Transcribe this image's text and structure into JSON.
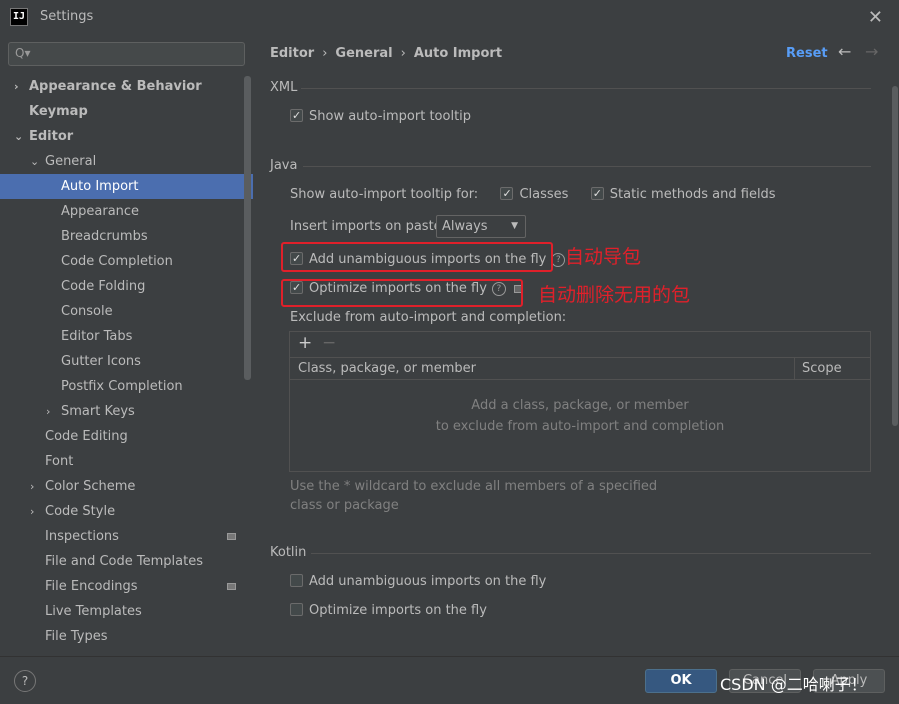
{
  "window": {
    "title": "Settings",
    "app_icon_text": "IJ"
  },
  "search": {
    "placeholder": "Q▾"
  },
  "sidebar": {
    "items": [
      {
        "label": "Appearance & Behavior",
        "level": 0,
        "bold": true,
        "chevron": "›"
      },
      {
        "label": "Keymap",
        "level": 0,
        "bold": true,
        "chevron": ""
      },
      {
        "label": "Editor",
        "level": 0,
        "bold": true,
        "chevron": "⌄"
      },
      {
        "label": "General",
        "level": 1,
        "bold": false,
        "chevron": "⌄"
      },
      {
        "label": "Auto Import",
        "level": 2,
        "bold": false,
        "chevron": "",
        "selected": true
      },
      {
        "label": "Appearance",
        "level": 2,
        "bold": false,
        "chevron": ""
      },
      {
        "label": "Breadcrumbs",
        "level": 2,
        "bold": false,
        "chevron": ""
      },
      {
        "label": "Code Completion",
        "level": 2,
        "bold": false,
        "chevron": ""
      },
      {
        "label": "Code Folding",
        "level": 2,
        "bold": false,
        "chevron": ""
      },
      {
        "label": "Console",
        "level": 2,
        "bold": false,
        "chevron": ""
      },
      {
        "label": "Editor Tabs",
        "level": 2,
        "bold": false,
        "chevron": ""
      },
      {
        "label": "Gutter Icons",
        "level": 2,
        "bold": false,
        "chevron": ""
      },
      {
        "label": "Postfix Completion",
        "level": 2,
        "bold": false,
        "chevron": ""
      },
      {
        "label": "Smart Keys",
        "level": 2,
        "bold": false,
        "chevron": "›"
      },
      {
        "label": "Code Editing",
        "level": 1,
        "bold": false,
        "chevron": ""
      },
      {
        "label": "Font",
        "level": 1,
        "bold": false,
        "chevron": ""
      },
      {
        "label": "Color Scheme",
        "level": 1,
        "bold": false,
        "chevron": "›"
      },
      {
        "label": "Code Style",
        "level": 1,
        "bold": false,
        "chevron": "›"
      },
      {
        "label": "Inspections",
        "level": 1,
        "bold": false,
        "chevron": "",
        "marker": true
      },
      {
        "label": "File and Code Templates",
        "level": 1,
        "bold": false,
        "chevron": ""
      },
      {
        "label": "File Encodings",
        "level": 1,
        "bold": false,
        "chevron": "",
        "marker": true
      },
      {
        "label": "Live Templates",
        "level": 1,
        "bold": false,
        "chevron": ""
      },
      {
        "label": "File Types",
        "level": 1,
        "bold": false,
        "chevron": ""
      }
    ]
  },
  "header": {
    "breadcrumb": [
      "Editor",
      "General",
      "Auto Import"
    ],
    "sep": "›",
    "reset_label": "Reset",
    "back_icon": "←",
    "forward_icon": "→"
  },
  "xml": {
    "title": "XML",
    "show_tooltip": {
      "label": "Show auto-import tooltip",
      "checked": true
    }
  },
  "java": {
    "title": "Java",
    "tooltip_for_label": "Show auto-import tooltip for:",
    "classes": {
      "label": "Classes",
      "checked": true
    },
    "static_methods": {
      "label": "Static methods and fields",
      "checked": true
    },
    "insert_label": "Insert imports on paste:",
    "insert_value": "Always",
    "add_unambiguous": {
      "label": "Add unambiguous imports on the fly",
      "checked": true
    },
    "optimize": {
      "label": "Optimize imports on the fly",
      "checked": true
    },
    "exclude_label": "Exclude from auto-import and completion:",
    "table": {
      "add_icon": "+",
      "remove_icon": "−",
      "col_main": "Class, package, or member",
      "col_scope": "Scope",
      "empty_line1": "Add a class, package, or member",
      "empty_line2": "to exclude from auto-import and completion"
    },
    "hint": "Use the * wildcard to exclude all members of a specified class or package"
  },
  "kotlin": {
    "title": "Kotlin",
    "add_unambiguous": {
      "label": "Add unambiguous imports on the fly",
      "checked": false
    },
    "optimize": {
      "label": "Optimize imports on the fly",
      "checked": false
    }
  },
  "annotations": {
    "note1": "自动导包",
    "note2": "自动删除无用的包",
    "color": "#e0202a"
  },
  "footer": {
    "help_label": "?",
    "ok_label": "OK",
    "cancel_label": "Cancel",
    "apply_label": "Apply",
    "watermark": "CSDN @二哈喇子！"
  },
  "colors": {
    "accent": "#4b6eaf",
    "link": "#589df6",
    "ok_button": "#365880"
  }
}
